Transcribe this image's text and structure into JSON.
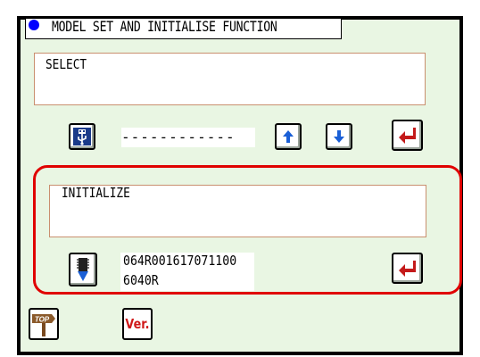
{
  "title": "MODEL SET AND INITIALISE FUNCTION",
  "select": {
    "label": "SELECT",
    "value": "------------"
  },
  "initialize": {
    "label": "INITIALIZE",
    "line1": "064R001617071100",
    "line2": "6040R"
  },
  "bottom": {
    "top_label": "TOP",
    "ver_label": "Ver."
  },
  "colors": {
    "panel": "#e9f6e3",
    "accent_red": "#e00000",
    "arrow_blue": "#1a5fd6",
    "enter_red": "#c41a1a",
    "title_dot": "#0000ff"
  },
  "icons": [
    "usb-icon",
    "arrow-up-icon",
    "arrow-down-icon",
    "enter-icon",
    "download-icon",
    "top-signpost-icon"
  ]
}
